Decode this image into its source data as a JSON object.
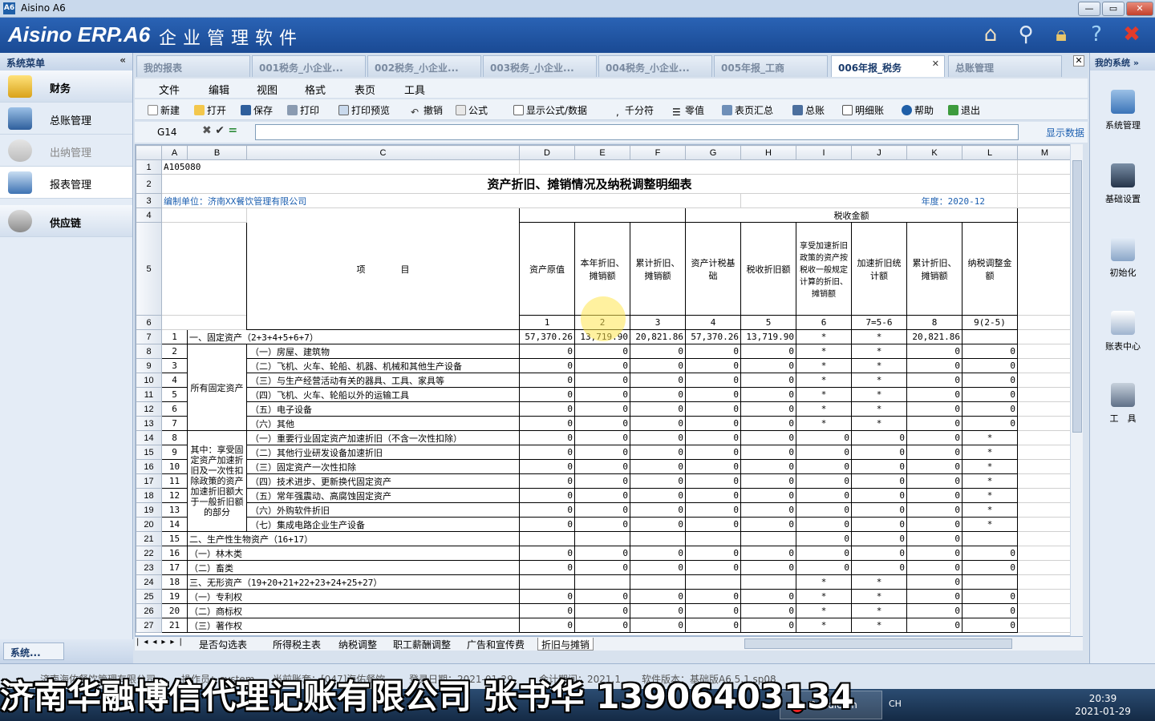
{
  "window": {
    "title": "Aisino A6",
    "min": "—",
    "max": "▭",
    "close": "✕"
  },
  "banner": {
    "brand": "Aisino ERP.A6",
    "subtitle": "企业管理软件"
  },
  "left_panel": {
    "header": "系统菜单",
    "collapse": "«",
    "items": [
      "财务",
      "总账管理",
      "出纳管理",
      "报表管理",
      "供应链"
    ],
    "bottom": "系统..."
  },
  "tabs": [
    "我的报表",
    "001税务_小企业...",
    "002税务_小企业...",
    "003税务_小企业...",
    "004税务_小企业...",
    "005年报_工商",
    "006年报_税务",
    "总账管理"
  ],
  "tab_close": "✕",
  "right_panel": {
    "header": "我的系统",
    "expand": "»",
    "items": [
      "系统管理",
      "基础设置",
      "初始化",
      "账表中心",
      "工　具"
    ]
  },
  "menu": [
    "文件",
    "编辑",
    "视图",
    "格式",
    "表页",
    "工具"
  ],
  "toolbar": [
    "新建",
    "打开",
    "保存",
    "打印",
    "打印预览",
    "撤销",
    "公式",
    "显示公式/数据",
    "千分符",
    "零值",
    "表页汇总",
    "总账",
    "明细账",
    "帮助",
    "退出"
  ],
  "formula_bar": {
    "cell": "G14",
    "value": "",
    "show_data": "显示数据"
  },
  "columns": [
    "A",
    "B",
    "C",
    "D",
    "E",
    "F",
    "G",
    "H",
    "I",
    "J",
    "K",
    "L",
    "M"
  ],
  "sheet": {
    "code": "A105080",
    "title": "资产折旧、摊销情况及纳税调整明细表",
    "unit": "编制单位：济南XX餐饮管理有限公司",
    "year": "年度：2020-12",
    "tax_amount": "税收金额",
    "item_header": "项　　　　目",
    "headers": [
      "资产原值",
      "本年折旧、摊销额",
      "累计折旧、摊销额",
      "资产计税基础",
      "税收折旧额",
      "享受加速折旧政策的资产按税收一般规定计算的折旧、摊销额",
      "加速折旧统计额",
      "累计折旧、摊销额",
      "纳税调整金额"
    ],
    "header_nums": [
      "1",
      "2",
      "3",
      "4",
      "5",
      "6",
      "7=5-6",
      "8",
      "9(2-5)"
    ],
    "group1": "所有固定资产",
    "group2": "其中：享受固定资产加速折旧及一次性扣除政策的资产加速折旧额大于一般折旧额的部分",
    "rows": [
      {
        "n": "1",
        "label": "一、固定资产（2+3+4+5+6+7）",
        "v": [
          "57,370.26",
          "13,719.90",
          "20,821.86",
          "57,370.26",
          "13,719.90",
          "*",
          "*",
          "20,821.86",
          ""
        ]
      },
      {
        "n": "2",
        "label": "（一）房屋、建筑物",
        "v": [
          "0",
          "0",
          "0",
          "0",
          "0",
          "*",
          "*",
          "0",
          "0"
        ]
      },
      {
        "n": "3",
        "label": "（二）飞机、火车、轮船、机器、机械和其他生产设备",
        "v": [
          "0",
          "0",
          "0",
          "0",
          "0",
          "*",
          "*",
          "0",
          "0"
        ]
      },
      {
        "n": "4",
        "label": "（三）与生产经营活动有关的器具、工具、家具等",
        "v": [
          "0",
          "0",
          "0",
          "0",
          "0",
          "*",
          "*",
          "0",
          "0"
        ]
      },
      {
        "n": "5",
        "label": "（四）飞机、火车、轮船以外的运输工具",
        "v": [
          "0",
          "0",
          "0",
          "0",
          "0",
          "*",
          "*",
          "0",
          "0"
        ]
      },
      {
        "n": "6",
        "label": "（五）电子设备",
        "v": [
          "0",
          "0",
          "0",
          "0",
          "0",
          "*",
          "*",
          "0",
          "0"
        ]
      },
      {
        "n": "7",
        "label": "（六）其他",
        "v": [
          "0",
          "0",
          "0",
          "0",
          "0",
          "*",
          "*",
          "0",
          "0"
        ]
      },
      {
        "n": "8",
        "label": "（一）重要行业固定资产加速折旧（不含一次性扣除）",
        "v": [
          "0",
          "0",
          "0",
          "0",
          "0",
          "0",
          "0",
          "0",
          "*"
        ]
      },
      {
        "n": "9",
        "label": "（二）其他行业研发设备加速折旧",
        "v": [
          "0",
          "0",
          "0",
          "0",
          "0",
          "0",
          "0",
          "0",
          "*"
        ]
      },
      {
        "n": "10",
        "label": "（三）固定资产一次性扣除",
        "v": [
          "0",
          "0",
          "0",
          "0",
          "0",
          "0",
          "0",
          "0",
          "*"
        ]
      },
      {
        "n": "11",
        "label": "（四）技术进步、更新换代固定资产",
        "v": [
          "0",
          "0",
          "0",
          "0",
          "0",
          "0",
          "0",
          "0",
          "*"
        ]
      },
      {
        "n": "12",
        "label": "（五）常年强震动、高腐蚀固定资产",
        "v": [
          "0",
          "0",
          "0",
          "0",
          "0",
          "0",
          "0",
          "0",
          "*"
        ]
      },
      {
        "n": "13",
        "label": "（六）外购软件折旧",
        "v": [
          "0",
          "0",
          "0",
          "0",
          "0",
          "0",
          "0",
          "0",
          "*"
        ]
      },
      {
        "n": "14",
        "label": "（七）集成电路企业生产设备",
        "v": [
          "0",
          "0",
          "0",
          "0",
          "0",
          "0",
          "0",
          "0",
          "*"
        ]
      },
      {
        "n": "15",
        "label": "二、生产性生物资产（16+17）",
        "v": [
          "",
          "",
          "",
          "",
          "",
          "0",
          "0",
          "0",
          ""
        ]
      },
      {
        "n": "16",
        "label": "（一）林木类",
        "v": [
          "0",
          "0",
          "0",
          "0",
          "0",
          "0",
          "0",
          "0",
          "0"
        ]
      },
      {
        "n": "17",
        "label": "（二）畜类",
        "v": [
          "0",
          "0",
          "0",
          "0",
          "0",
          "0",
          "0",
          "0",
          "0"
        ]
      },
      {
        "n": "18",
        "label": "三、无形资产（19+20+21+22+23+24+25+27）",
        "v": [
          "",
          "",
          "",
          "",
          "",
          "*",
          "*",
          "0",
          ""
        ]
      },
      {
        "n": "19",
        "label": "（一）专利权",
        "v": [
          "0",
          "0",
          "0",
          "0",
          "0",
          "*",
          "*",
          "0",
          "0"
        ]
      },
      {
        "n": "20",
        "label": "（二）商标权",
        "v": [
          "0",
          "0",
          "0",
          "0",
          "0",
          "*",
          "*",
          "0",
          "0"
        ]
      },
      {
        "n": "21",
        "label": "（三）著作权",
        "v": [
          "0",
          "0",
          "0",
          "0",
          "0",
          "*",
          "*",
          "0",
          "0"
        ]
      }
    ]
  },
  "sheet_tabs": [
    "是否勾选表",
    "所得税主表",
    "纳税调整",
    "职工薪酬调整",
    "广告和宣传费",
    "折旧与摊销"
  ],
  "status": [
    "济南海佑餐饮管理有限公司",
    "操作员：system",
    "当前账套：[047]海佑餐饮",
    "登录日期：2021-01-29",
    "会计期间：2021.1",
    "软件版本：基础版A6 5.1.sp08"
  ],
  "taskbar": {
    "app": "Bandicam",
    "tray": "CH",
    "time": "20:39",
    "date": "2021-01-29"
  },
  "overlay": "济南华融博信代理记账有限公司 张书华 13906403134"
}
